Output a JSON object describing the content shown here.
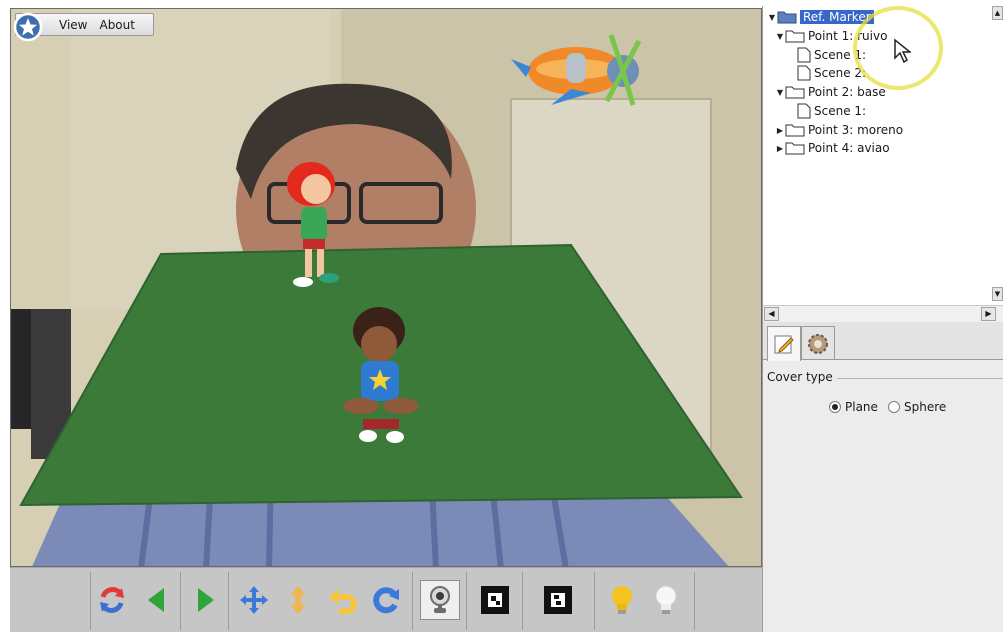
{
  "menu": {
    "view_label": "View",
    "about_label": "About"
  },
  "tree": {
    "root": "Ref. Marker",
    "nodes": [
      {
        "label": "Point 1: ruivo",
        "expanded": true,
        "children": [
          "Scene 1:",
          "Scene 2:"
        ]
      },
      {
        "label": "Point 2: base",
        "expanded": true,
        "children": [
          "Scene 1:"
        ]
      },
      {
        "label": "Point 3: moreno",
        "expanded": false,
        "children": []
      },
      {
        "label": "Point 4: aviao",
        "expanded": false,
        "children": []
      }
    ]
  },
  "props": {
    "cover_type_label": "Cover type",
    "options": [
      {
        "label": "Plane",
        "selected": true
      },
      {
        "label": "Sphere",
        "selected": false
      }
    ]
  },
  "toolbar": {
    "buttons": [
      "refresh-icon",
      "arrow-left-icon",
      "arrow-right-icon",
      "move-icon",
      "vertical-move-icon",
      "undo-icon",
      "redo-icon",
      "webcam-icon",
      "marker-1-icon",
      "marker-2-icon",
      "light-on-icon",
      "light-off-icon"
    ]
  },
  "colors": {
    "selection": "#3967c8",
    "floor": "#3c7a3a",
    "toolbar": "#c6c6c6"
  }
}
